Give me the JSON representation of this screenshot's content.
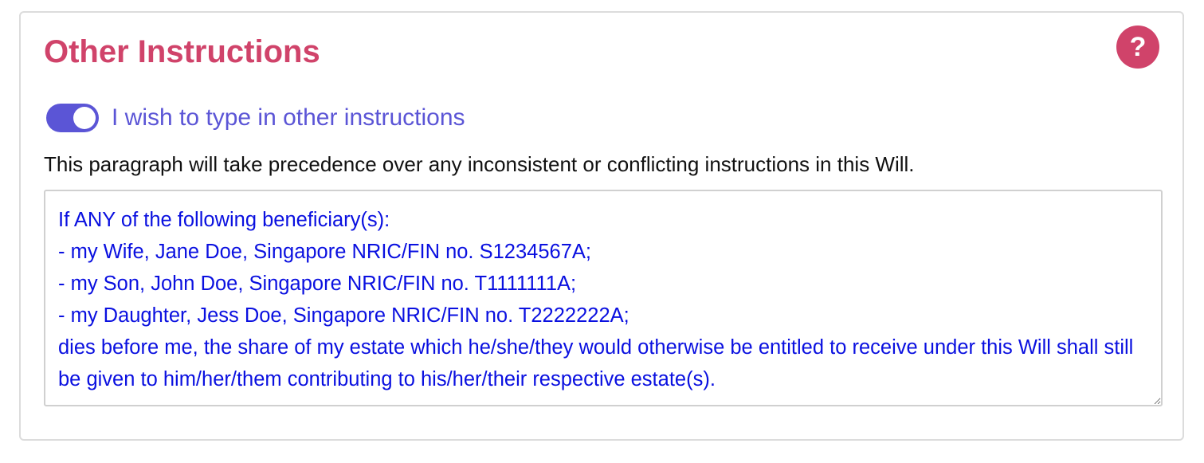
{
  "section": {
    "title": "Other Instructions",
    "help_label": "?"
  },
  "toggle": {
    "label": "I wish to type in other instructions",
    "checked": true,
    "accent": "#5b55d6"
  },
  "note": "This paragraph will take precedence over any inconsistent or conflicting instructions in this Will.",
  "instructions": {
    "value": "If ANY of the following beneficiary(s):\n- my Wife, Jane Doe, Singapore NRIC/FIN no. S1234567A;\n- my Son, John Doe, Singapore NRIC/FIN no. T1111111A;\n- my Daughter, Jess Doe, Singapore NRIC/FIN no. T2222222A;\ndies before me, the share of my estate which he/she/they would otherwise be entitled to receive under this Will shall still be given to him/her/them contributing to his/her/their respective estate(s)."
  },
  "colors": {
    "title": "#d0436a",
    "help_button": "#d0436a",
    "textarea_text": "#0a10e0",
    "card_border": "#dcdcdc"
  },
  "icons": {
    "help": "question-mark-circle-icon",
    "resize": "resize-handle-icon"
  }
}
